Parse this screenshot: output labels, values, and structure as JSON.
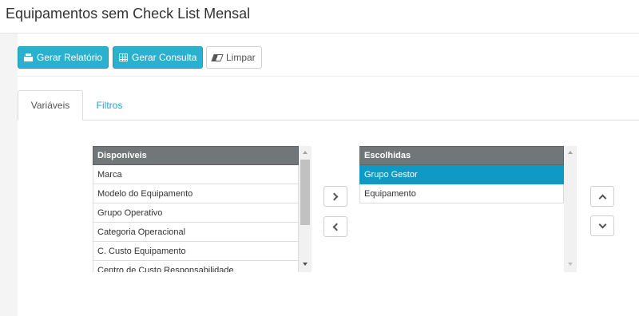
{
  "page": {
    "title": "Equipamentos sem Check List Mensal"
  },
  "toolbar": {
    "gerar_relatorio": "Gerar Relatório",
    "gerar_consulta": "Gerar Consulta",
    "limpar": "Limpar"
  },
  "tabs": [
    {
      "label": "Variáveis",
      "active": true
    },
    {
      "label": "Filtros",
      "active": false
    }
  ],
  "available": {
    "header": "Disponíveis",
    "items": [
      "Marca",
      "Modelo do Equipamento",
      "Grupo Operativo",
      "Categoria Operacional",
      "C. Custo Equipamento",
      "Centro de Custo Responsabilidade"
    ]
  },
  "chosen": {
    "header": "Escolhidas",
    "items": [
      "Grupo Gestor",
      "Equipamento"
    ],
    "selected_index": 0
  },
  "icons": {
    "print": "print-icon",
    "table": "table-icon",
    "eraser": "eraser-icon",
    "move_right": "chevron-right-icon",
    "move_left": "chevron-left-icon",
    "move_up": "chevron-up-icon",
    "move_down": "chevron-down-icon"
  },
  "colors": {
    "primary": "#2cb0d0",
    "selected_row": "#0e9ac4",
    "list_header": "#717778",
    "tab_link": "#2a9fd6"
  }
}
